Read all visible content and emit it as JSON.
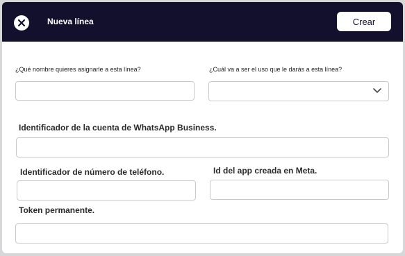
{
  "header": {
    "title": "Nueva línea",
    "create_label": "Crear",
    "close_icon": "close-circle-icon"
  },
  "form": {
    "line_name_label": "¿Qué nombre quieres asignarle a esta línea?",
    "line_name_value": "",
    "line_use_label": "¿Cuál va a ser el uso que le darás a esta línea?",
    "line_use_value": "",
    "whatsapp_account_label": "Identificador de la cuenta de WhatsApp Business.",
    "whatsapp_account_value": "",
    "phone_id_label": "Identificador de número de teléfono.",
    "phone_id_value": "",
    "app_id_label": "Id del app creada en Meta.",
    "app_id_value": "",
    "token_label": "Token permanente.",
    "token_value": ""
  },
  "colors": {
    "header_bg": "#13102e",
    "border": "#c9c9cc"
  }
}
